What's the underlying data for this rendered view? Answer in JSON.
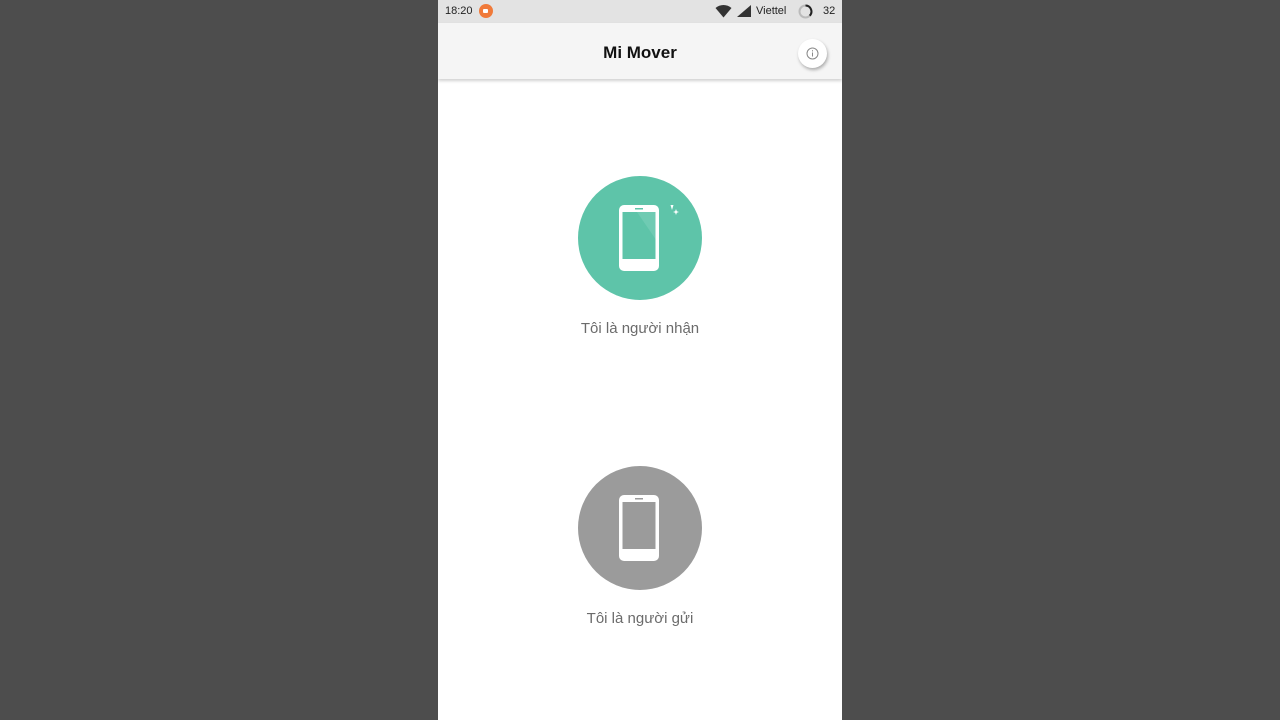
{
  "status_bar": {
    "time": "18:20",
    "carrier": "Viettel",
    "battery": "32",
    "icons": [
      "screen-record-icon",
      "wifi-icon",
      "signal-icon",
      "battery-icon"
    ]
  },
  "app_bar": {
    "title": "Mi Mover",
    "info_icon": "info-icon"
  },
  "options": {
    "receiver": {
      "label": "Tôi là người nhận",
      "color": "#5ec4a9",
      "icon": "phone-sparkle-icon"
    },
    "sender": {
      "label": "Tôi là người gửi",
      "color": "#9b9b9b",
      "icon": "phone-icon"
    }
  },
  "colors": {
    "background": "#4d4d4d",
    "screen": "#ffffff",
    "status_bar": "#e3e3e3",
    "app_bar": "#f5f5f5"
  }
}
